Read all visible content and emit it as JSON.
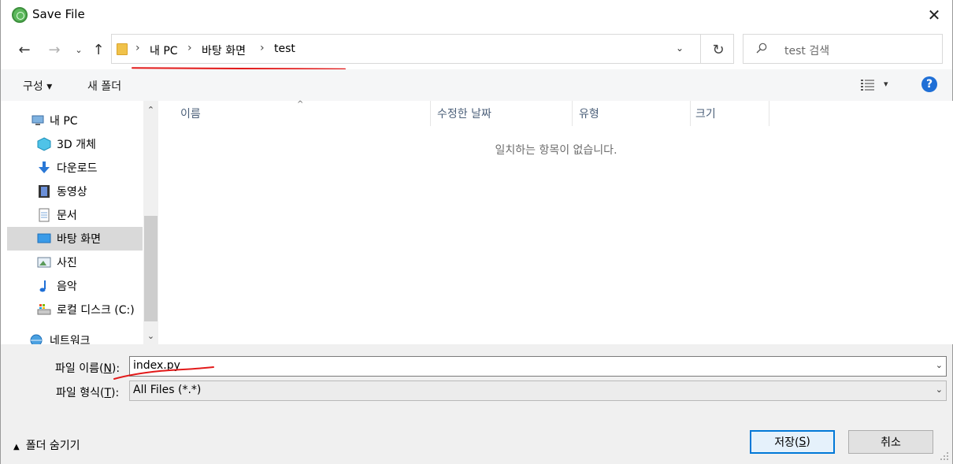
{
  "window": {
    "title": "Save File",
    "close_glyph": "✕"
  },
  "nav": {
    "back_glyph": "←",
    "forward_glyph": "→",
    "recent_glyph": "⌄",
    "up_glyph": "↑"
  },
  "address": {
    "crumbs": [
      "내 PC",
      "바탕 화면",
      "test"
    ],
    "separator": "›",
    "dropdown_glyph": "⌄",
    "refresh_glyph": "↻"
  },
  "search": {
    "placeholder": "test 검색"
  },
  "toolbar": {
    "organize_label": "구성 ▾",
    "new_folder_label": "새 폴더",
    "view_dropdown_glyph": "▾",
    "help_label": "?"
  },
  "sidebar": {
    "items": [
      {
        "label": "내 PC",
        "icon": "computer-icon"
      },
      {
        "label": "3D 개체",
        "icon": "cube-icon"
      },
      {
        "label": "다운로드",
        "icon": "download-icon"
      },
      {
        "label": "동영상",
        "icon": "video-icon"
      },
      {
        "label": "문서",
        "icon": "document-icon"
      },
      {
        "label": "바탕 화면",
        "icon": "desktop-icon"
      },
      {
        "label": "사진",
        "icon": "picture-icon"
      },
      {
        "label": "음악",
        "icon": "music-icon"
      },
      {
        "label": "로컬 디스크 (C:)",
        "icon": "drive-icon"
      },
      {
        "label": "네트워크",
        "icon": "network-icon"
      }
    ],
    "selected_index": 5,
    "scroll_up_glyph": "⌃",
    "scroll_down_glyph": "⌄"
  },
  "filelist": {
    "columns": [
      "이름",
      "수정한 날짜",
      "유형",
      "크기"
    ],
    "sort_glyph": "^",
    "empty_message": "일치하는 항목이 없습니다."
  },
  "form": {
    "filename_label": "파일 이름(",
    "filename_accel": "N",
    "filename_label_end": "):",
    "filename_value": "index.py",
    "filetype_label": "파일 형식(",
    "filetype_accel": "T",
    "filetype_label_end": "):",
    "filetype_value": "All Files (*.*)",
    "chevron_glyph": "⌄"
  },
  "footer": {
    "hide_folders_label": "폴더 숨기기",
    "hide_glyph": "▲",
    "save_label": "저장(",
    "save_accel": "S",
    "save_label_end": ")",
    "cancel_label": "취소"
  },
  "colors": {
    "accent": "#0078d7",
    "annotation_red": "#e21a1a",
    "selected_bg": "#d9d9d9",
    "help_blue": "#1f6fd6"
  }
}
